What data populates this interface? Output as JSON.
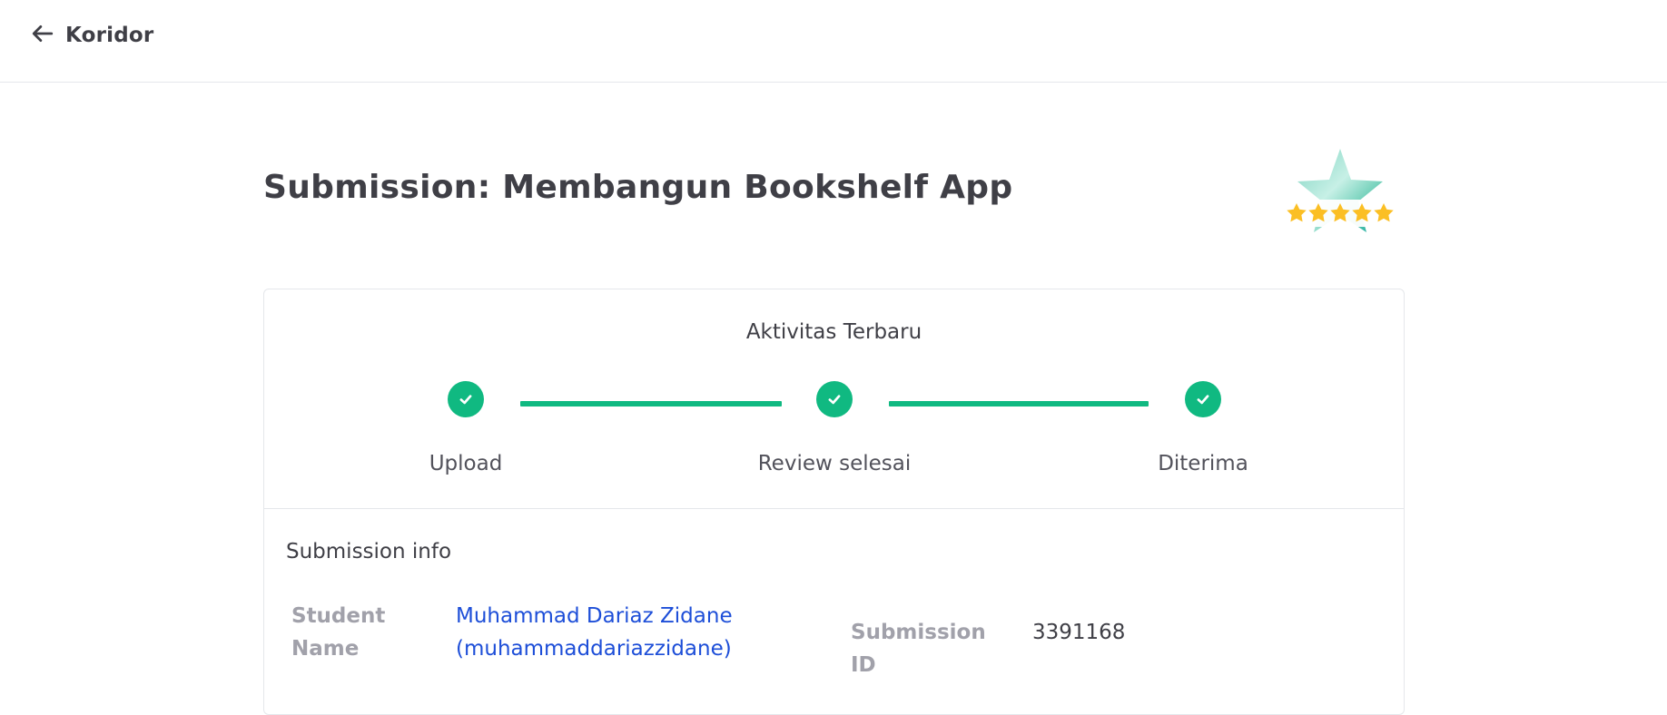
{
  "header": {
    "back_label": "Koridor"
  },
  "page": {
    "title": "Submission: Membangun Bookshelf App",
    "rating_stars": 5
  },
  "activity": {
    "title": "Aktivitas Terbaru",
    "steps": [
      {
        "label": "Upload",
        "status": "done"
      },
      {
        "label": "Review selesai",
        "status": "done"
      },
      {
        "label": "Diterima",
        "status": "done"
      }
    ]
  },
  "submission_info": {
    "title": "Submission info",
    "student_name_label_1": "Student",
    "student_name_label_2": "Name",
    "student_name_line_1": "Muhammad Dariaz Zidane",
    "student_name_line_2": "(muhammaddariazzidane)",
    "submission_id_label_1": "Submission",
    "submission_id_label_2": "ID",
    "submission_id": "3391168"
  },
  "colors": {
    "accent": "#10b981",
    "link": "#1d4ed8",
    "muted": "#a1a1aa",
    "text": "#3f3f46",
    "star": "#fbbf24"
  }
}
